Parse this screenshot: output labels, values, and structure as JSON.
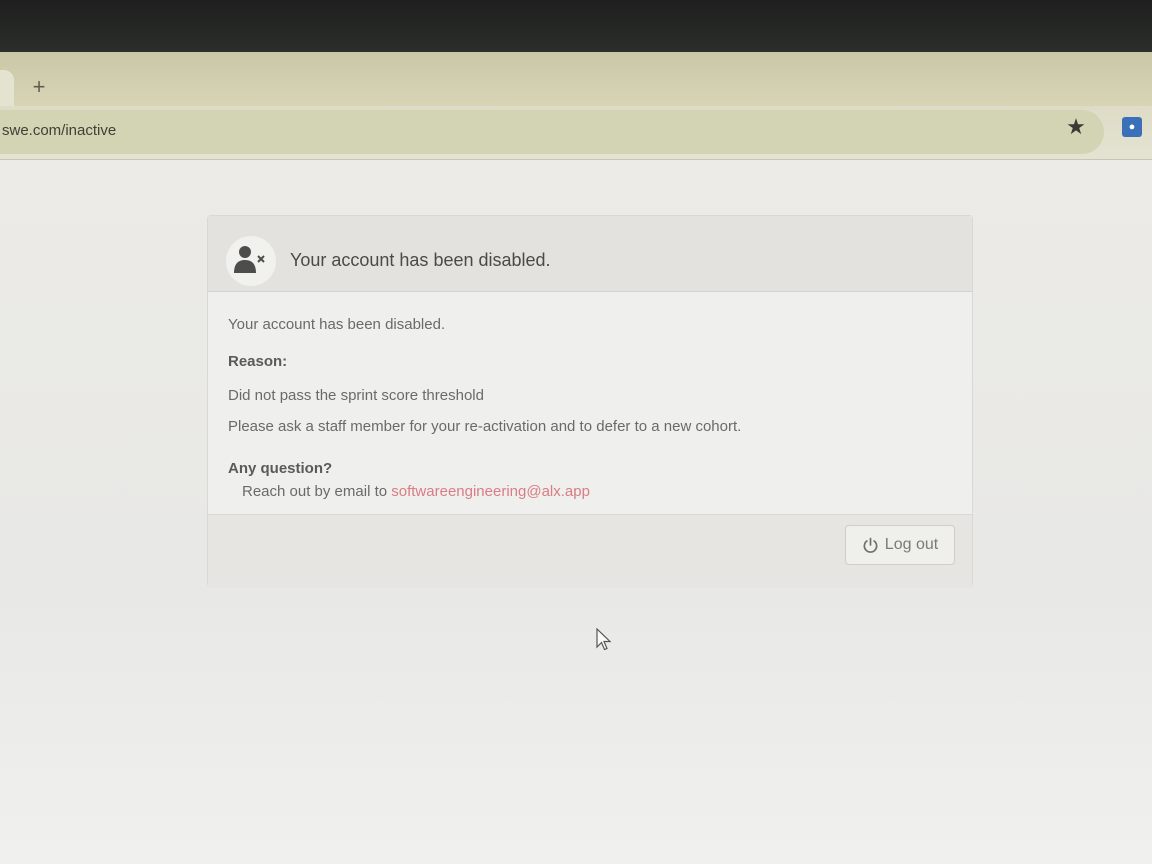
{
  "browser": {
    "new_tab_label": "+",
    "url": "swe.com/inactive",
    "bookmark_icon": "star-icon",
    "extension_icon": "extension-icon"
  },
  "card": {
    "header_icon": "user-x-icon",
    "title": "Your account has been disabled.",
    "body": {
      "message": "Your account has been disabled.",
      "reason_label": "Reason:",
      "reason_text": "Did not pass the sprint score threshold",
      "instruction": "Please ask a staff member for your re-activation and to defer to a new cohort.",
      "question_label": "Any question?",
      "contact_prefix": "Reach out by email to ",
      "contact_email": "softwareengineering@alx.app"
    },
    "footer": {
      "logout_icon": "power-icon",
      "logout_label": "Log out"
    }
  },
  "colors": {
    "link": "#d97d83",
    "text": "#6a6a66",
    "card_header": "#e3e2de"
  }
}
